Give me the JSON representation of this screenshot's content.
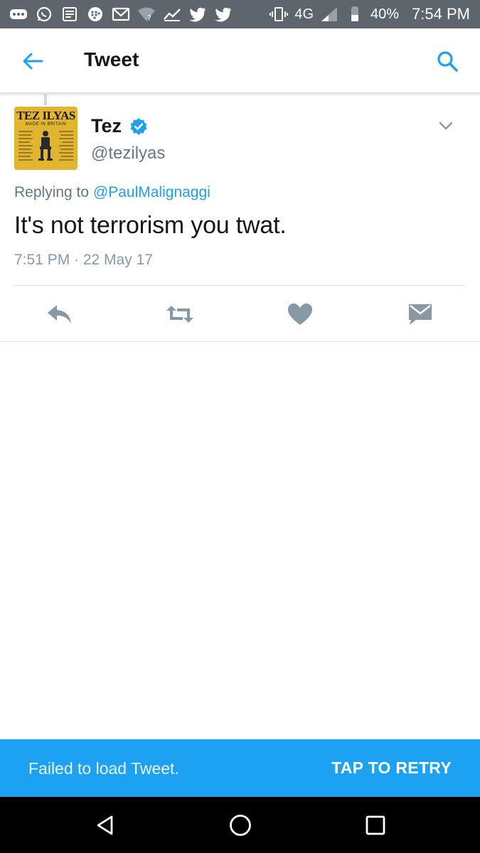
{
  "status_bar": {
    "battery_percent": "40%",
    "time": "7:54 PM",
    "network": "4G",
    "icons": [
      "more-icon",
      "whatsapp-icon",
      "news-icon",
      "blackberry-icon",
      "gmail-icon",
      "wifi-unknown-icon",
      "signal-graph-icon",
      "twitter-icon",
      "twitter-icon",
      "vibrate-icon",
      "4g-icon",
      "cell-signal-icon",
      "battery-icon"
    ]
  },
  "app_bar": {
    "title": "Tweet",
    "back_icon": "arrow-left-icon",
    "search_icon": "search-icon",
    "accent_color": "#1da1f2"
  },
  "tweet": {
    "author_name": "Tez",
    "author_handle": "@tezilyas",
    "verified": true,
    "avatar": {
      "title": "TEZ ILYAS",
      "subtitle": "MADE IN BRITAIN"
    },
    "replying_prefix": "Replying to ",
    "replying_to": "@PaulMalignaggi",
    "text": "It's not terrorism you twat.",
    "timestamp": "7:51 PM · 22 May 17"
  },
  "actions": [
    {
      "name": "reply",
      "icon": "reply-icon"
    },
    {
      "name": "retweet",
      "icon": "retweet-icon"
    },
    {
      "name": "like",
      "icon": "heart-icon"
    },
    {
      "name": "direct-message",
      "icon": "envelope-icon"
    }
  ],
  "retry_banner": {
    "message": "Failed to load Tweet.",
    "action_label": "TAP TO RETRY",
    "background_color": "#1da1f2"
  },
  "nav_bar": {
    "buttons": [
      "back-triangle-icon",
      "home-circle-icon",
      "recents-square-icon"
    ]
  }
}
